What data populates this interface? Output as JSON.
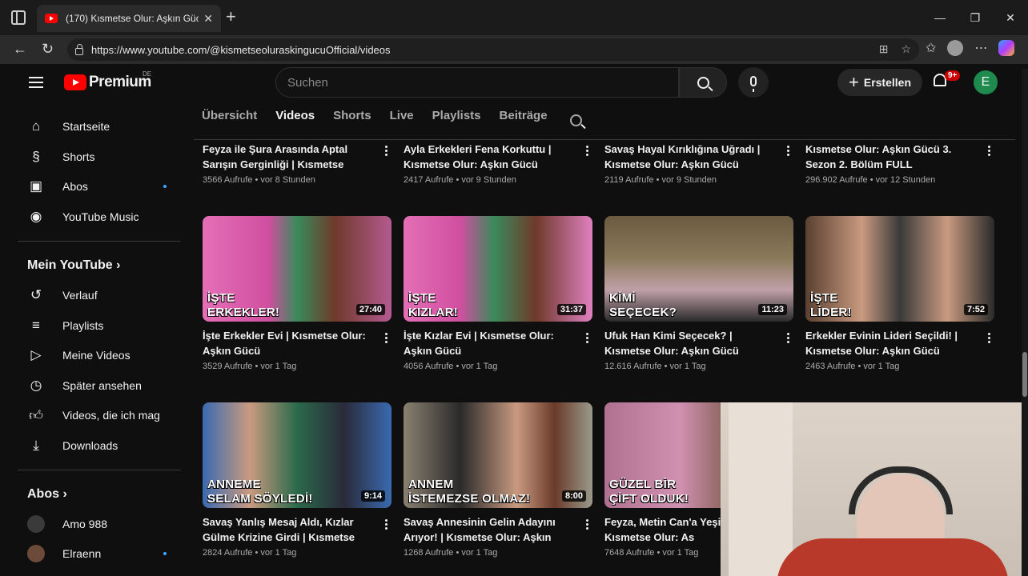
{
  "browser": {
    "tab_title": "(170) Kısmetse Olur: Aşkın Gücü",
    "url": "https://www.youtube.com/@kismetseoluraskingucuOfficial/videos"
  },
  "masthead": {
    "logo_text": "Premium",
    "logo_region": "DE",
    "search_placeholder": "Suchen",
    "create_label": "Erstellen",
    "notif_count": "9+",
    "avatar_letter": "E"
  },
  "sidebar": {
    "main": [
      {
        "label": "Startseite",
        "icon": "home-icon"
      },
      {
        "label": "Shorts",
        "icon": "shorts-icon"
      },
      {
        "label": "Abos",
        "icon": "subscriptions-icon"
      },
      {
        "label": "YouTube Music",
        "icon": "music-icon"
      }
    ],
    "you_header": "Mein YouTube",
    "you": [
      {
        "label": "Verlauf",
        "icon": "history-icon"
      },
      {
        "label": "Playlists",
        "icon": "playlists-icon"
      },
      {
        "label": "Meine Videos",
        "icon": "my-videos-icon"
      },
      {
        "label": "Später ansehen",
        "icon": "watch-later-icon"
      },
      {
        "label": "Videos, die ich mag",
        "icon": "like-icon"
      },
      {
        "label": "Downloads",
        "icon": "download-icon"
      }
    ],
    "subs_header": "Abos",
    "subs": [
      {
        "label": "Amo 988"
      },
      {
        "label": "Elraenn"
      }
    ]
  },
  "channel_tabs": [
    "Übersicht",
    "Videos",
    "Shorts",
    "Live",
    "Playlists",
    "Beiträge"
  ],
  "videos_row1": [
    {
      "title": "Feyza ile Şura Arasında Aptal Sarışın Gerginliği | Kısmetse Olur:...",
      "meta": "3566 Aufrufe • vor 8 Stunden"
    },
    {
      "title": "Ayla Erkekleri Fena Korkuttu | Kısmetse Olur: Aşkın Gücü",
      "meta": "2417 Aufrufe • vor 9 Stunden"
    },
    {
      "title": "Savaş Hayal Kırıklığına Uğradı | Kısmetse Olur: Aşkın Gücü",
      "meta": "2119 Aufrufe • vor 9 Stunden"
    },
    {
      "title": "Kısmetse Olur: Aşkın Gücü 3. Sezon 2. Bölüm FULL",
      "meta": "296.902 Aufrufe • vor 12 Stunden"
    }
  ],
  "videos_row2": [
    {
      "title": "İşte Erkekler Evi | Kısmetse Olur: Aşkın Gücü",
      "meta": "3529 Aufrufe • vor 1 Tag",
      "thumb_l1": "İŞTE",
      "thumb_l2": "ERKEKLER!",
      "duration": "27:40"
    },
    {
      "title": "İşte Kızlar Evi | Kısmetse Olur: Aşkın Gücü",
      "meta": "4056 Aufrufe • vor 1 Tag",
      "thumb_l1": "İŞTE",
      "thumb_l2": "KIZLAR!",
      "duration": "31:37"
    },
    {
      "title": "Ufuk Han Kimi Seçecek? | Kısmetse Olur: Aşkın Gücü",
      "meta": "12.616 Aufrufe • vor 1 Tag",
      "thumb_l1": "KİMİ",
      "thumb_l2": "SEÇECEK?",
      "duration": "11:23"
    },
    {
      "title": "Erkekler Evinin Lideri Seçildi! | Kısmetse Olur: Aşkın Gücü",
      "meta": "2463 Aufrufe • vor 1 Tag",
      "thumb_l1": "İŞTE",
      "thumb_l2": "LİDER!",
      "duration": "7:52"
    }
  ],
  "videos_row3": [
    {
      "title": "Savaş Yanlış Mesaj Aldı, Kızlar Gülme Krizine Girdi | Kısmetse Olu...",
      "meta": "2824 Aufrufe • vor 1 Tag",
      "thumb_l1": "ANNEME",
      "thumb_l2": "SELAM SÖYLEDİ!",
      "duration": "9:14"
    },
    {
      "title": "Savaş Annesinin Gelin Adayını Arıyor! | Kısmetse Olur: Aşkın Gücü",
      "meta": "1268 Aufrufe • vor 1 Tag",
      "thumb_l1": "ANNEM",
      "thumb_l2": "İSTEMEZSE OLMAZ!",
      "duration": "8:00"
    },
    {
      "title": "Feyza, Metin Can'a Yeşil ♥🔥 | Kısmetse Olur: As",
      "meta": "7648 Aufrufe • vor 1 Tag",
      "thumb_l1": "GÜZEL BİR",
      "thumb_l2": "ÇİFT OLDUK!",
      "duration": ""
    }
  ]
}
